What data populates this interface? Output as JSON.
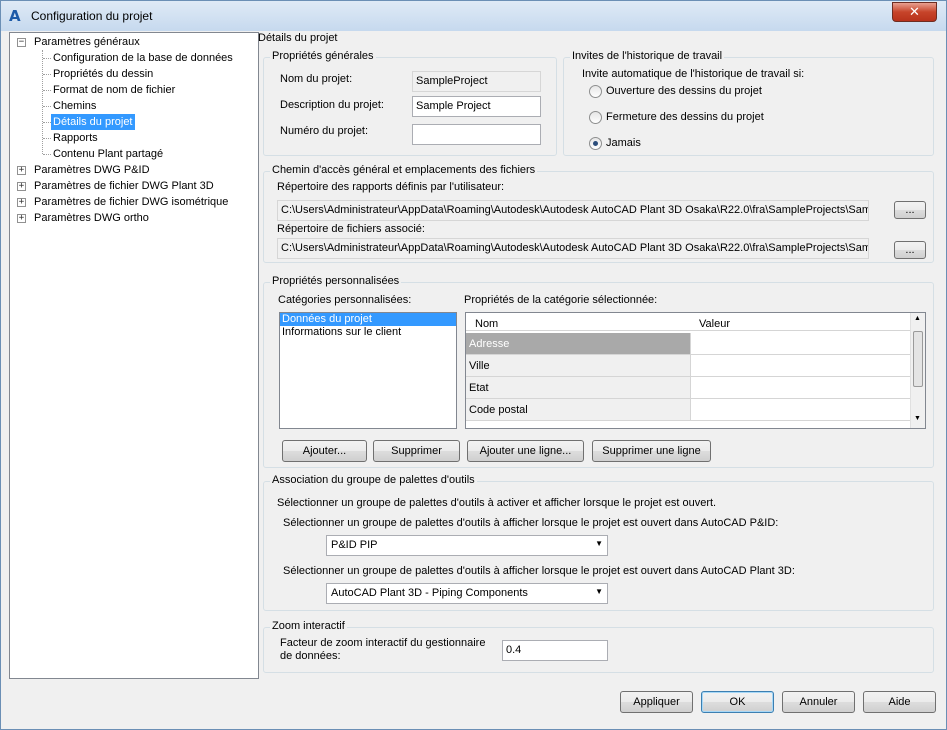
{
  "window": {
    "title": "Configuration du projet",
    "close_glyph": "✕",
    "app_glyph": "A"
  },
  "tree": {
    "root": {
      "label": "Paramètres généraux",
      "expander": "−"
    },
    "children": [
      {
        "label": "Configuration de la base de données"
      },
      {
        "label": "Propriétés du dessin"
      },
      {
        "label": "Format de nom de fichier"
      },
      {
        "label": "Chemins"
      },
      {
        "label": "Détails du projet",
        "selected": true
      },
      {
        "label": "Rapports"
      },
      {
        "label": "Contenu Plant partagé"
      }
    ],
    "others": [
      {
        "label": "Paramètres DWG P&ID",
        "expander": "+"
      },
      {
        "label": "Paramètres de fichier DWG Plant 3D",
        "expander": "+"
      },
      {
        "label": "Paramètres de fichier DWG isométrique",
        "expander": "+"
      },
      {
        "label": "Paramètres DWG ortho",
        "expander": "+"
      }
    ]
  },
  "panel": {
    "title": "Détails du projet",
    "general": {
      "title": "Propriétés générales",
      "name_label": "Nom du projet:",
      "name_value": "SampleProject",
      "desc_label": "Description du projet:",
      "desc_value": "Sample Project",
      "number_label": "Numéro du projet:",
      "number_value": ""
    },
    "history": {
      "title": "Invites de l'historique de travail",
      "prompt_label": "Invite automatique de l'historique de travail si:",
      "options": [
        "Ouverture des dessins du projet",
        "Fermeture des dessins du projet",
        "Jamais"
      ],
      "selected": "Jamais"
    },
    "paths": {
      "title": "Chemin d'accès général et emplacements des fichiers",
      "reports_label": "Répertoire des rapports définis par l'utilisateur:",
      "reports_value": "C:\\Users\\Administrateur\\AppData\\Roaming\\Autodesk\\Autodesk AutoCAD Plant 3D Osaka\\R22.0\\fra\\SampleProjects\\Sam",
      "files_label": "Répertoire de fichiers associé:",
      "files_value": "C:\\Users\\Administrateur\\AppData\\Roaming\\Autodesk\\Autodesk AutoCAD Plant 3D Osaka\\R22.0\\fra\\SampleProjects\\Sam",
      "browse_label": "..."
    },
    "custom": {
      "title": "Propriétés personnalisées",
      "categories_label": "Catégories personnalisées:",
      "categories": [
        "Données du projet",
        "Informations sur le client"
      ],
      "selected_category": "Données du projet",
      "props_label": "Propriétés de la catégorie sélectionnée:",
      "columns": [
        "Nom",
        "Valeur"
      ],
      "rows": [
        {
          "name": "Adresse",
          "value": ""
        },
        {
          "name": "Ville",
          "value": ""
        },
        {
          "name": "Etat",
          "value": ""
        },
        {
          "name": "Code postal",
          "value": ""
        }
      ],
      "buttons": {
        "add": "Ajouter...",
        "delete": "Supprimer",
        "add_line": "Ajouter une ligne...",
        "delete_line": "Supprimer une ligne"
      }
    },
    "palettes": {
      "title": "Association du groupe de palettes d'outils",
      "intro": "Sélectionner un groupe de palettes d'outils à activer et afficher lorsque le projet est ouvert.",
      "pid_label": "Sélectionner un groupe de palettes d'outils à afficher lorsque le projet est ouvert dans AutoCAD P&ID:",
      "pid_value": "P&ID PIP",
      "plant_label": "Sélectionner un groupe de palettes d'outils à afficher lorsque le projet est ouvert dans AutoCAD Plant 3D:",
      "plant_value": "AutoCAD Plant 3D - Piping Components"
    },
    "zoom": {
      "title": "Zoom interactif",
      "label_line1": "Facteur de zoom interactif du gestionnaire",
      "label_line2": "de données:",
      "value": "0.4"
    }
  },
  "footer": {
    "apply": "Appliquer",
    "ok": "OK",
    "cancel": "Annuler",
    "help": "Aide"
  }
}
